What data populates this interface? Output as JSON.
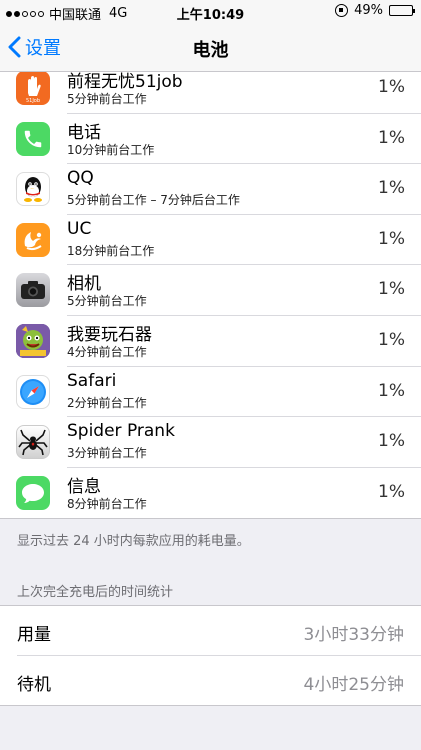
{
  "status_bar": {
    "carrier": "中国联通",
    "network": "4G",
    "time": "上午10:49",
    "battery": "49%",
    "battery_level": 0.49,
    "signal_filled": 2,
    "signal_total": 5
  },
  "nav": {
    "back_label": "设置",
    "title": "电池"
  },
  "apps": [
    {
      "name": "前程无忧51job",
      "detail": "5分钟前台工作",
      "percent": "1%",
      "icon": "51job-icon"
    },
    {
      "name": "电话",
      "detail": "10分钟前台工作",
      "percent": "1%",
      "icon": "phone-icon"
    },
    {
      "name": "QQ",
      "detail": "5分钟前台工作 – 7分钟后台工作",
      "percent": "1%",
      "icon": "qq-icon"
    },
    {
      "name": "UC",
      "detail": "18分钟前台工作",
      "percent": "1%",
      "icon": "uc-browser-icon"
    },
    {
      "name": "相机",
      "detail": "5分钟前台工作",
      "percent": "1%",
      "icon": "camera-icon"
    },
    {
      "name": "我要玩石器",
      "detail": "4分钟前台工作",
      "percent": "1%",
      "icon": "game-icon"
    },
    {
      "name": "Safari",
      "detail": "2分钟前台工作",
      "percent": "1%",
      "icon": "safari-icon"
    },
    {
      "name": "Spider Prank",
      "detail": "3分钟前台工作",
      "percent": "1%",
      "icon": "spider-icon"
    },
    {
      "name": "信息",
      "detail": "8分钟前台工作",
      "percent": "1%",
      "icon": "messages-icon"
    }
  ],
  "footer_note": "显示过去 24 小时内每款应用的耗电量。",
  "section_header": "上次完全充电后的时间统计",
  "stats": [
    {
      "label": "用量",
      "value": "3小时33分钟"
    },
    {
      "label": "待机",
      "value": "4小时25分钟"
    }
  ],
  "colors": {
    "accent": "#007aff",
    "background": "#efeff4"
  }
}
